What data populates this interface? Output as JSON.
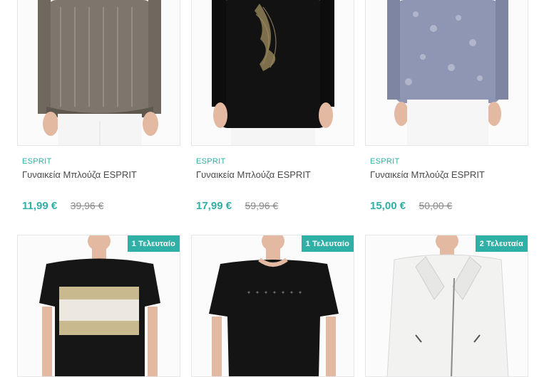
{
  "products_row1": [
    {
      "brand": "ESPRIT",
      "title": "Γυναικεία Μπλούζα ESPRIT",
      "price": "11,99 €",
      "old_price": "39,96 €"
    },
    {
      "brand": "ESPRIT",
      "title": "Γυναικεία Μπλούζα ESPRIT",
      "price": "17,99 €",
      "old_price": "59,96 €"
    },
    {
      "brand": "ESPRIT",
      "title": "Γυναικεία Μπλούζα ESPRIT",
      "price": "15,00 €",
      "old_price": "50,00 €"
    }
  ],
  "products_row2": [
    {
      "badge": "1 Τελευταίο"
    },
    {
      "badge": "1 Τελευταίο"
    },
    {
      "badge": "2 Τελευταία"
    }
  ],
  "colors": {
    "accent": "#2fb0a6"
  }
}
